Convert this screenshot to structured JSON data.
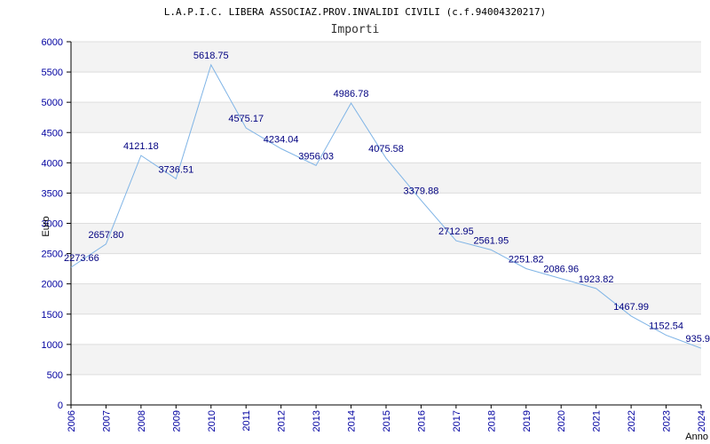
{
  "chart_data": {
    "type": "line",
    "title": "L.A.P.I.C. LIBERA ASSOCIAZ.PROV.INVALIDI CIVILI (c.f.94004320217)",
    "subtitle": "Importi",
    "xlabel": "Anno",
    "ylabel": "Euro",
    "x": [
      "2006",
      "2007",
      "2008",
      "2009",
      "2010",
      "2011",
      "2012",
      "2013",
      "2014",
      "2015",
      "2016",
      "2017",
      "2018",
      "2019",
      "2020",
      "2021",
      "2022",
      "2023",
      "2024"
    ],
    "series": [
      {
        "values": [
          2273.66,
          2657.8,
          4121.18,
          3736.51,
          5618.75,
          4575.17,
          4234.04,
          3956.03,
          4986.78,
          4075.58,
          3379.88,
          2712.95,
          2561.95,
          2251.82,
          2086.96,
          1923.82,
          1467.99,
          1152.54,
          935.9
        ],
        "labels": [
          "2273.66",
          "2657.80",
          "4121.18",
          "3736.51",
          "5618.75",
          "4575.17",
          "4234.04",
          "3956.03",
          "4986.78",
          "4075.58",
          "3379.88",
          "2712.95",
          "2561.95",
          "2251.82",
          "2086.96",
          "1923.82",
          "1467.99",
          "1152.54",
          "935.9"
        ]
      }
    ],
    "ylim": [
      0,
      6000
    ],
    "yticks": [
      "0",
      "500",
      "1000",
      "1500",
      "2000",
      "2500",
      "3000",
      "3500",
      "4000",
      "4500",
      "5000",
      "5500",
      "6000"
    ],
    "grid": true,
    "colors": {
      "line": "#7fb4e6",
      "band": "#f3f3f3",
      "grid": "#dddddd",
      "tick": "#0000a0",
      "label": "#000080"
    }
  }
}
